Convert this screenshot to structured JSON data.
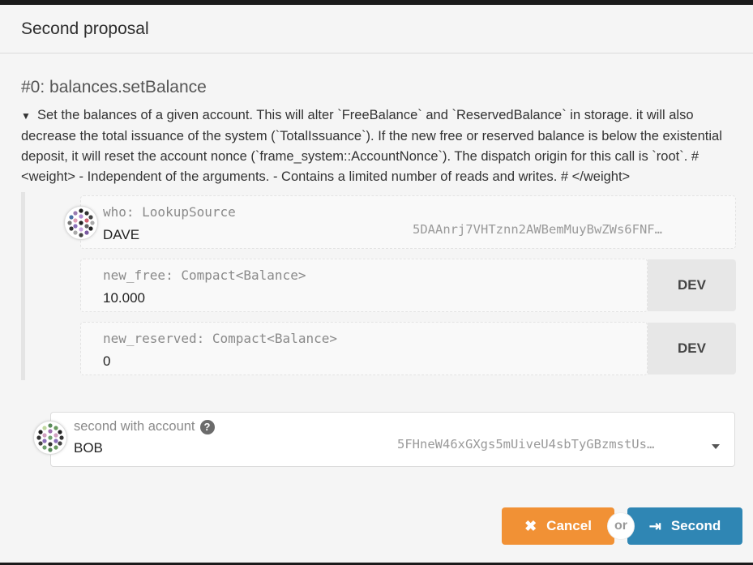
{
  "modal": {
    "title": "Second proposal"
  },
  "call": {
    "title": "#0: balances.setBalance",
    "docs_toggle": "▼",
    "docs": "Set the balances of a given account. This will alter `FreeBalance` and `ReservedBalance` in storage. it will also decrease the total issuance of the system (`TotalIssuance`). If the new free or reserved balance is below the existential deposit, it will reset the account nonce (`frame_system::AccountNonce`). The dispatch origin for this call is `root`. # <weight> - Independent of the arguments. - Contains a limited number of reads and writes. # </weight>"
  },
  "params": {
    "who": {
      "label": "who: LookupSource",
      "name": "DAVE",
      "address": "5DAAnrj7VHTznn2AWBemMuyBwZWs6FNF…"
    },
    "new_free": {
      "label": "new_free: Compact<Balance>",
      "value": "10.000",
      "unit": "DEV"
    },
    "new_reserved": {
      "label": "new_reserved: Compact<Balance>",
      "value": "0",
      "unit": "DEV"
    }
  },
  "account": {
    "label": "second with account",
    "help_icon": "question-circle-icon",
    "name": "BOB",
    "address": "5FHneW46xGXgs5mUiveU4sbTyGBzmstUs…"
  },
  "actions": {
    "cancel_label": "Cancel",
    "cancel_icon": "✖",
    "or_label": "or",
    "second_label": "Second",
    "second_icon": "⇥",
    "cancel_color": "#f19135",
    "second_color": "#2f86b4"
  }
}
